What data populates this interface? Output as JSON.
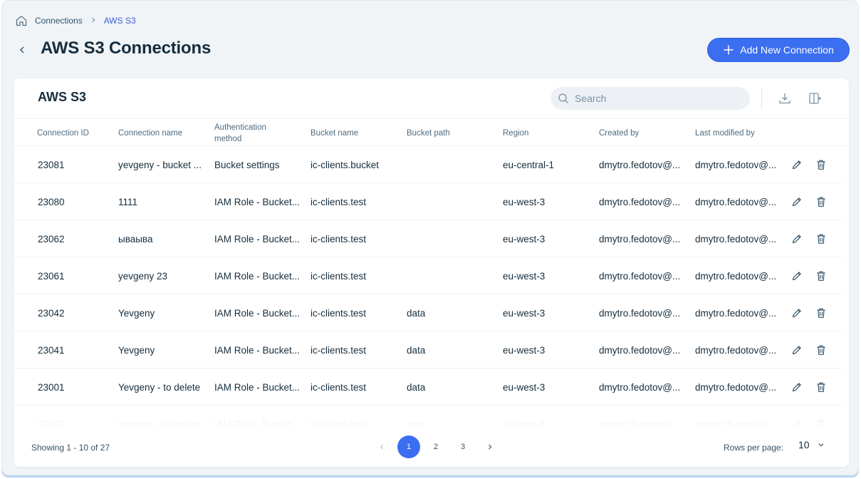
{
  "breadcrumb": {
    "home_icon": "home-icon",
    "items": [
      "Connections",
      "AWS S3"
    ]
  },
  "page": {
    "title": "AWS S3 Connections",
    "add_button": "Add New Connection"
  },
  "card": {
    "title": "AWS S3",
    "search_placeholder": "Search"
  },
  "table": {
    "columns": [
      "Connection ID",
      "Connection name",
      "Authentication method",
      "Bucket name",
      "Bucket path",
      "Region",
      "Created by",
      "Last modified by"
    ],
    "rows": [
      {
        "id": "23081",
        "name": "yevgeny - bucket ...",
        "auth": "Bucket settings",
        "bucket": "ic-clients.bucket",
        "path": "",
        "region": "eu-central-1",
        "created": "dmytro.fedotov@...",
        "modified": "dmytro.fedotov@..."
      },
      {
        "id": "23080",
        "name": "1111",
        "auth": "IAM Role - Bucket...",
        "bucket": "ic-clients.test",
        "path": "",
        "region": "eu-west-3",
        "created": "dmytro.fedotov@...",
        "modified": "dmytro.fedotov@..."
      },
      {
        "id": "23062",
        "name": "ываыва",
        "auth": "IAM Role - Bucket...",
        "bucket": "ic-clients.test",
        "path": "",
        "region": "eu-west-3",
        "created": "dmytro.fedotov@...",
        "modified": "dmytro.fedotov@..."
      },
      {
        "id": "23061",
        "name": "yevgeny 23",
        "auth": "IAM Role - Bucket...",
        "bucket": "ic-clients.test",
        "path": "",
        "region": "eu-west-3",
        "created": "dmytro.fedotov@...",
        "modified": "dmytro.fedotov@..."
      },
      {
        "id": "23042",
        "name": "Yevgeny",
        "auth": "IAM Role - Bucket...",
        "bucket": "ic-clients.test",
        "path": "data",
        "region": "eu-west-3",
        "created": "dmytro.fedotov@...",
        "modified": "dmytro.fedotov@..."
      },
      {
        "id": "23041",
        "name": "Yevgeny",
        "auth": "IAM Role - Bucket...",
        "bucket": "ic-clients.test",
        "path": "data",
        "region": "eu-west-3",
        "created": "dmytro.fedotov@...",
        "modified": "dmytro.fedotov@..."
      },
      {
        "id": "23001",
        "name": "Yevgeny - to delete",
        "auth": "IAM Role - Bucket...",
        "bucket": "ic-clients.test",
        "path": "data",
        "region": "eu-west-3",
        "created": "dmytro.fedotov@...",
        "modified": "dmytro.fedotov@..."
      },
      {
        "id": "23000",
        "name": "Yevgeny - to delete",
        "auth": "IAM Role - Bucket...",
        "bucket": "ic-clients.test",
        "path": "data",
        "region": "eu-west-3",
        "created": "dmytro.fedotov@...",
        "modified": "dmytro.fedotov@..."
      }
    ]
  },
  "footer": {
    "showing": "Showing 1 - 10 of 27",
    "pages": [
      "1",
      "2",
      "3"
    ],
    "active_page": "1",
    "rows_per_page_label": "Rows per page:",
    "rows_per_page_value": "10"
  },
  "icons": {
    "row_actions": [
      "edit-icon",
      "delete-icon"
    ],
    "toolbar": [
      "download-icon",
      "customize-columns-icon"
    ]
  },
  "colors": {
    "accent": "#3b6ef0",
    "title": "#162d3d",
    "background": "#f0f4f7"
  }
}
